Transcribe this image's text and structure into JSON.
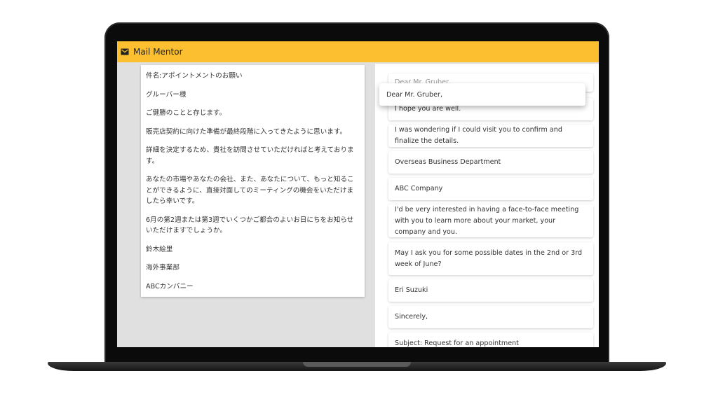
{
  "app": {
    "title": "Mail Mentor",
    "brand_color": "#fbbf2f",
    "icon": "envelope-icon"
  },
  "japanese_email": {
    "lines": [
      "件名:アポイントメントのお願い",
      "グルーバー様",
      "ご健勝のことと存じます。",
      "販売店契約に向けた準備が最終段階に入ってきたように思います。",
      "詳細を決定するため、貴社を訪問させていただければと考えております。",
      "あなたの市場やあなたの会社、また、あなたについて、もっと知ることができるように、直接対面してのミーティングの機会をいただけましたら幸いです。",
      "6月の第2週または第3週でいくつかご都合のよいお日にちをお知らせいただけますでしょうか。",
      "鈴木絵里",
      "海外事業部",
      "ABCカンパニー"
    ]
  },
  "english_cards": {
    "ghost_text": "Dear Mr. Gruber,",
    "items": [
      "I hope you are well.",
      "I was wondering if I could visit you to confirm and finalize the details.",
      "Overseas Business Department",
      "ABC Company",
      "I'd be very interested in having a face-to-face meeting with you to learn more about your market, your company and you.",
      "May I ask you for some possible dates in the 2nd or 3rd week of June?",
      "Eri Suzuki",
      "Sincerely,",
      "Subject: Request for an appointment"
    ],
    "dragging": "Dear Mr. Gruber,"
  }
}
